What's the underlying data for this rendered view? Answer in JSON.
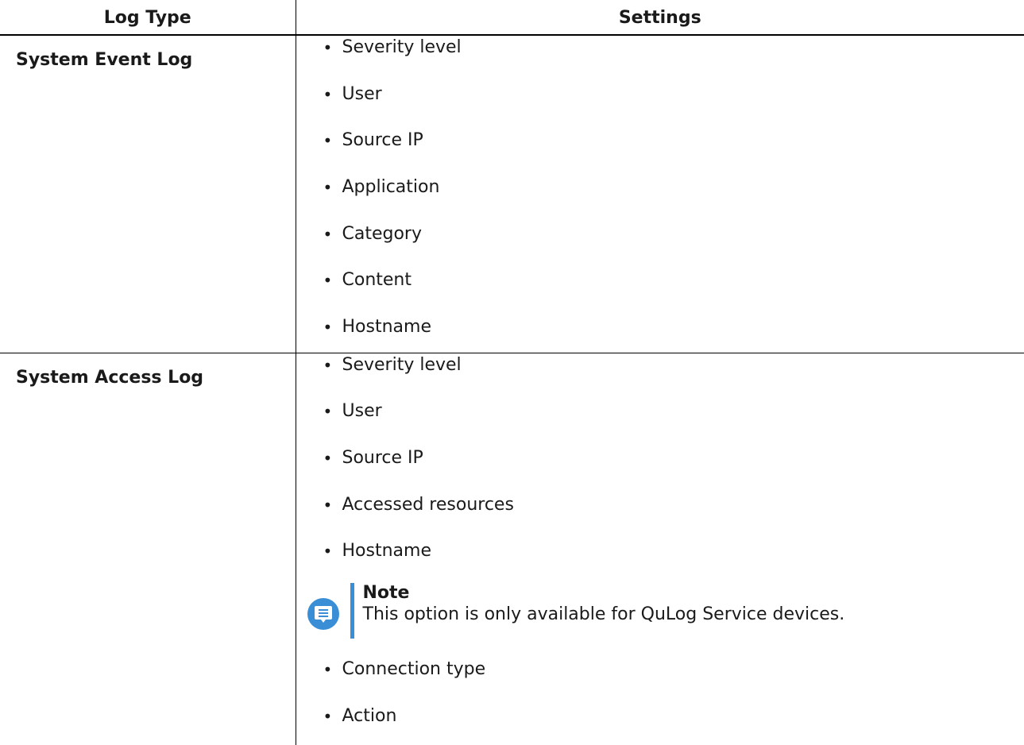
{
  "table": {
    "headers": {
      "log_type": "Log Type",
      "settings": "Settings"
    },
    "rows": [
      {
        "log_type": "System Event Log",
        "settings_before_note": [
          "Severity level",
          "User",
          "Source IP",
          "Application",
          "Category",
          "Content",
          "Hostname"
        ]
      },
      {
        "log_type": "System Access Log",
        "settings_before_note": [
          "Severity level",
          "User",
          "Source IP",
          "Accessed resources",
          "Hostname"
        ],
        "note": {
          "title": "Note",
          "text": "This option is only available for QuLog Service devices."
        },
        "settings_after_note": [
          "Connection type",
          "Action"
        ]
      }
    ]
  },
  "colors": {
    "note_accent": "#3a8ed6",
    "border": "#000000"
  },
  "icons": {
    "note": "note-speech-bubble-icon"
  }
}
